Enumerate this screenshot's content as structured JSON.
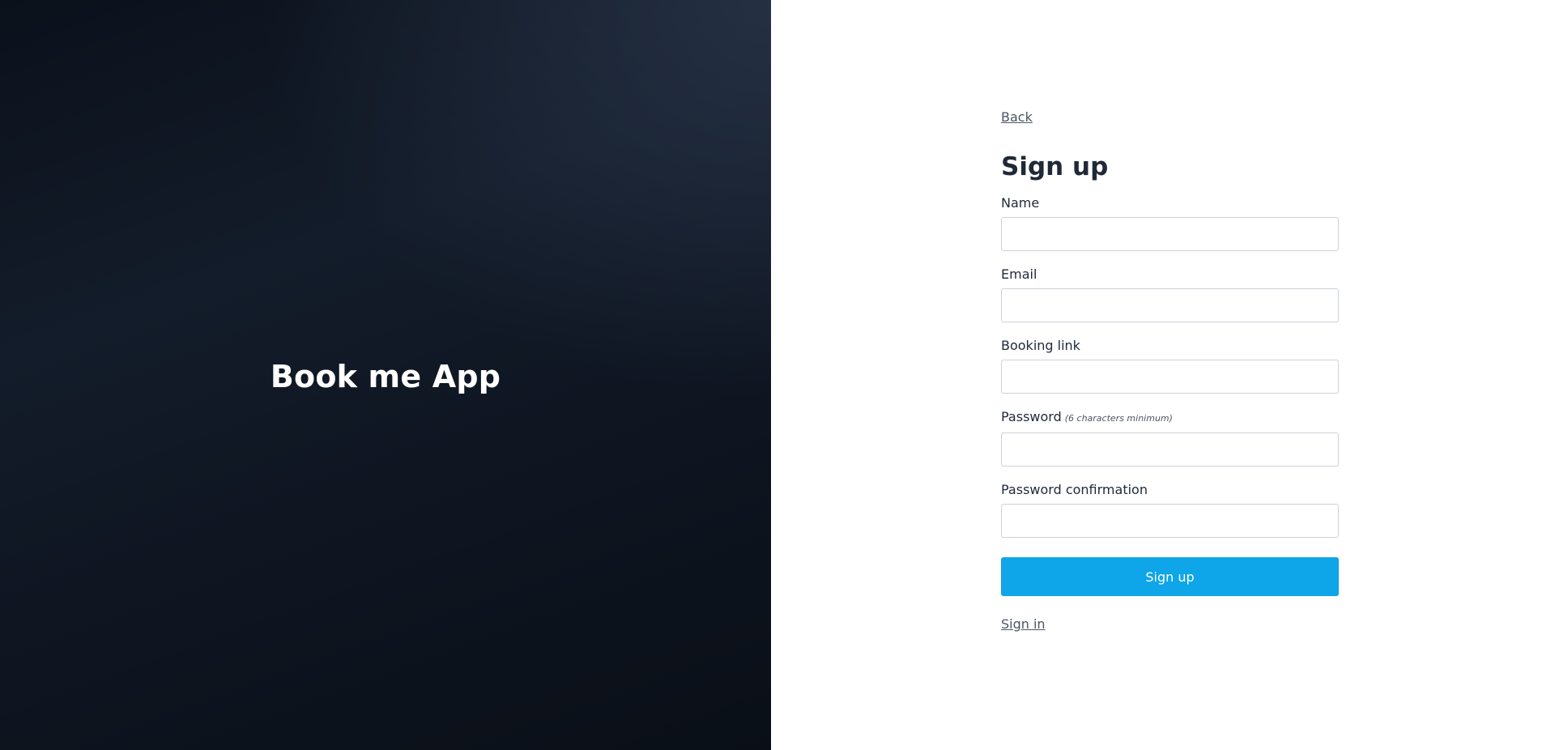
{
  "hero": {
    "title": "Book me App"
  },
  "form": {
    "back_label": "Back",
    "title": "Sign up",
    "fields": [
      {
        "label": "Name",
        "hint": "",
        "value": "",
        "placeholder": ""
      },
      {
        "label": "Email",
        "hint": "",
        "value": "",
        "placeholder": ""
      },
      {
        "label": "Booking link",
        "hint": "",
        "value": "",
        "placeholder": ""
      },
      {
        "label": "Password",
        "hint": "(6 characters minimum)",
        "value": "",
        "placeholder": ""
      },
      {
        "label": "Password confirmation",
        "hint": "",
        "value": "",
        "placeholder": ""
      }
    ],
    "submit_label": "Sign up",
    "signin_label": "Sign in"
  },
  "colors": {
    "accent": "#0ea5e9",
    "hero_background": "#111827",
    "text": "#1f2937",
    "input_border": "#cbd2da"
  }
}
